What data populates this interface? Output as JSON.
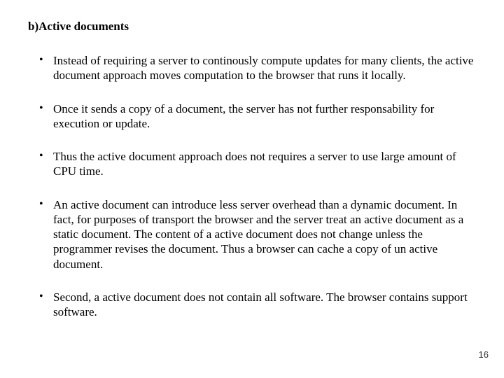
{
  "heading": "b)Active documents",
  "bullets": [
    "Instead of requiring a server to continously compute updates for many clients, the active document approach moves computation to the browser that runs it locally.",
    "Once  it sends a copy of a document, the server has not further responsability for execution or update.",
    "Thus the active document approach does not requires a server to use large amount of CPU time.",
    "An active document can introduce less server overhead than a dynamic document. In fact, for purposes of transport the browser and the server treat an active document as a static document. The content of a active document does not change unless the programmer revises the document. Thus a browser can cache a copy of un active document.",
    "Second, a active document does not contain all software. The browser contains support software."
  ],
  "page_number": "16"
}
